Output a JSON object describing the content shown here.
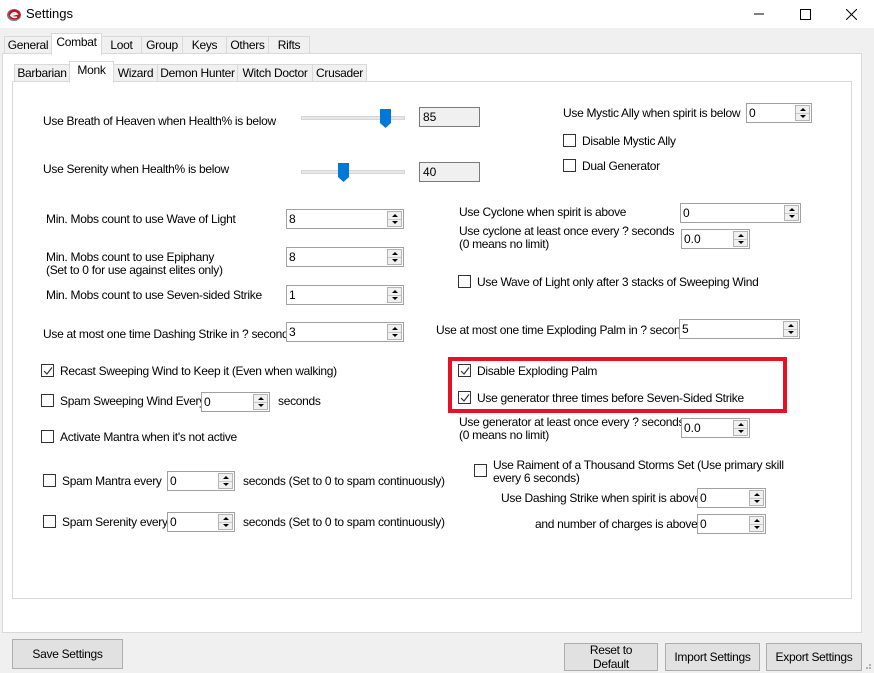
{
  "window": {
    "title": "Settings",
    "app_icon": "e-logo-icon",
    "controls": [
      "minimize-icon",
      "maximize-icon",
      "close-icon"
    ]
  },
  "main_tabs": [
    {
      "label": "General",
      "selected": false
    },
    {
      "label": "Combat",
      "selected": true
    },
    {
      "label": "Loot",
      "selected": false
    },
    {
      "label": "Group",
      "selected": false
    },
    {
      "label": "Keys",
      "selected": false
    },
    {
      "label": "Others",
      "selected": false
    },
    {
      "label": "Rifts",
      "selected": false
    }
  ],
  "class_tabs": [
    {
      "label": "Barbarian",
      "selected": false
    },
    {
      "label": "Monk",
      "selected": true
    },
    {
      "label": "Wizard",
      "selected": false
    },
    {
      "label": "Demon Hunter",
      "selected": false
    },
    {
      "label": "Witch Doctor",
      "selected": false
    },
    {
      "label": "Crusader",
      "selected": false
    }
  ],
  "monk": {
    "breath_of_heaven": {
      "label": "Use Breath of Heaven when Health% is below",
      "value": "85",
      "slider_percent": 85
    },
    "serenity": {
      "label": "Use Serenity when Health% is below",
      "value": "40",
      "slider_percent": 40
    },
    "mystic_ally": {
      "label": "Use Mystic Ally when spirit is below",
      "value": "0"
    },
    "disable_mystic_ally": {
      "label": "Disable Mystic Ally",
      "checked": false
    },
    "dual_generator": {
      "label": "Dual Generator",
      "checked": false
    },
    "wave_of_light_mobs": {
      "label": "Min. Mobs count to use Wave of Light",
      "value": "8"
    },
    "epiphany_mobs": {
      "label": "Min. Mobs count to use Epiphany",
      "sublabel": "(Set to 0 for use against elites only)",
      "value": "8"
    },
    "seven_sided_mobs": {
      "label": "Min. Mobs count to use Seven-sided Strike",
      "value": "1"
    },
    "dashing_strike_seconds": {
      "label": "Use at most one time Dashing Strike in ? seconds",
      "value": "3"
    },
    "cyclone_spirit": {
      "label": "Use Cyclone when spirit is above",
      "value": "0"
    },
    "cyclone_every": {
      "label": "Use cyclone at least once every ? seconds",
      "sublabel": "(0 means no limit)",
      "value": "0.0"
    },
    "wave_after_stacks": {
      "label": "Use Wave of Light only after 3 stacks of Sweeping Wind",
      "checked": false
    },
    "exploding_palm_seconds": {
      "label": "Use at most one time Exploding Palm in ? seconds",
      "value": "5"
    },
    "recast_sweeping_wind": {
      "label": "Recast Sweeping Wind to Keep it (Even when walking)",
      "checked": true
    },
    "spam_sweeping_wind": {
      "label": "Spam Sweeping Wind Every",
      "value": "0",
      "suffix": "seconds",
      "checked": false
    },
    "activate_mantra": {
      "label": "Activate Mantra when it's not active",
      "checked": false
    },
    "disable_exploding_palm": {
      "label": "Disable Exploding Palm",
      "checked": true
    },
    "generator_three_times": {
      "label": "Use generator three times before Seven-Sided Strike",
      "checked": true
    },
    "generator_every": {
      "label": "Use generator at least once every ? seconds",
      "sublabel": "(0 means no limit)",
      "value": "0.0"
    },
    "spam_mantra": {
      "label": "Spam Mantra every",
      "value": "0",
      "suffix": "seconds (Set to 0 to spam continuously)",
      "checked": false
    },
    "spam_serenity": {
      "label": "Spam Serenity every",
      "value": "0",
      "suffix": "seconds (Set to 0 to spam continuously)",
      "checked": false
    },
    "raiment_set": {
      "label": "Use Raiment of a Thousand Storms Set (Use primary skill",
      "label2": "every 6 seconds)",
      "checked": false
    },
    "raiment_dashing_spirit": {
      "label": "Use Dashing Strike when spirit is above",
      "value": "0"
    },
    "raiment_charges": {
      "label": "and number of charges is above",
      "value": "0"
    }
  },
  "footer": {
    "save": "Save Settings",
    "reset": "Reset to Default",
    "import": "Import Settings",
    "export": "Export Settings"
  },
  "colors": {
    "highlight": "#e81123",
    "slider_thumb": "#0078d7"
  }
}
